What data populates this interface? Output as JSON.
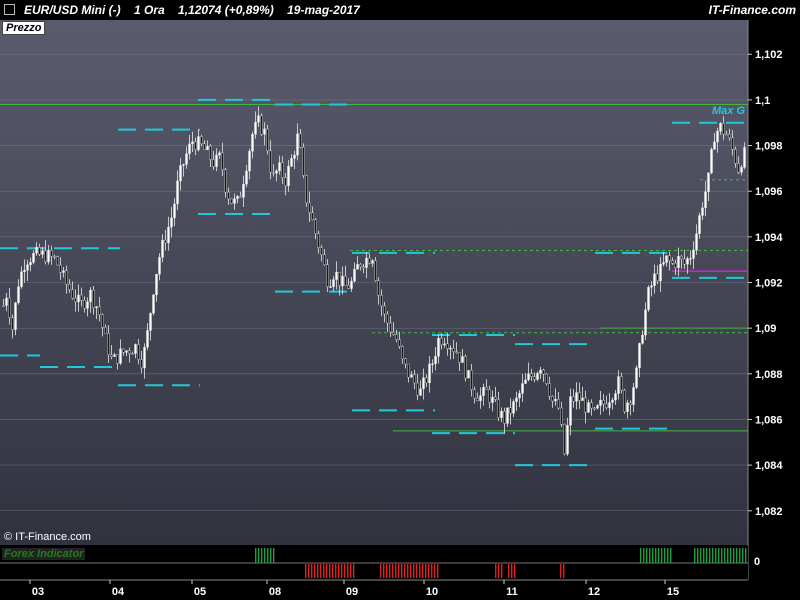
{
  "header": {
    "title": "EUR/USD Mini (-)",
    "timeframe": "1 Ora",
    "price": "1,12074 (+0,89%)",
    "date": "19-mag-2017",
    "brand": "IT-Finance.com"
  },
  "pane_label": "Prezzo",
  "copyright": "© IT-Finance.com",
  "max_label": "Max G",
  "indicator": {
    "label": "Forex Indicator",
    "value": "0"
  },
  "colors": {
    "bg_top": "#5a5c6e",
    "bg_bottom": "#30323e",
    "candle_up": "#ffffff",
    "candle_down": "#1a1a1a",
    "level_dash": "#22c8d8",
    "green_line": "#46b446",
    "purple_line": "#c030c0",
    "bar_green": "#1e9e3e",
    "bar_red": "#e02020"
  },
  "chart_data": {
    "type": "candlestick",
    "ylim": [
      1.0805,
      1.1035
    ],
    "yticks": [
      "1,102",
      "1,1",
      "1,098",
      "1,096",
      "1,094",
      "1,092",
      "1,09",
      "1,088",
      "1,086",
      "1,084",
      "1,082"
    ],
    "ytick_values": [
      1.102,
      1.1,
      1.098,
      1.096,
      1.094,
      1.092,
      1.09,
      1.088,
      1.086,
      1.084,
      1.082
    ],
    "xticks": [
      "03",
      "04",
      "05",
      "08",
      "09",
      "10",
      "11",
      "12",
      "15"
    ],
    "price_path": [
      [
        0,
        1.0905
      ],
      [
        6,
        1.0915
      ],
      [
        12,
        1.09
      ],
      [
        18,
        1.092
      ],
      [
        25,
        1.093
      ],
      [
        35,
        1.0932
      ],
      [
        45,
        1.0932
      ],
      [
        55,
        1.093
      ],
      [
        65,
        1.092
      ],
      [
        72,
        1.0915
      ],
      [
        80,
        1.091
      ],
      [
        90,
        1.0915
      ],
      [
        98,
        1.0908
      ],
      [
        105,
        1.0895
      ],
      [
        112,
        1.0885
      ],
      [
        118,
        1.0888
      ],
      [
        125,
        1.089
      ],
      [
        135,
        1.0892
      ],
      [
        142,
        1.0885
      ],
      [
        148,
        1.09
      ],
      [
        152,
        1.0915
      ],
      [
        158,
        1.093
      ],
      [
        165,
        1.094
      ],
      [
        172,
        1.095
      ],
      [
        178,
        1.0965
      ],
      [
        185,
        1.0975
      ],
      [
        192,
        1.0982
      ],
      [
        200,
        1.098
      ],
      [
        208,
        1.0976
      ],
      [
        214,
        1.0972
      ],
      [
        220,
        1.0975
      ],
      [
        226,
        1.096
      ],
      [
        232,
        1.0955
      ],
      [
        238,
        1.0955
      ],
      [
        245,
        1.097
      ],
      [
        252,
        1.0985
      ],
      [
        258,
        1.099
      ],
      [
        265,
        1.0985
      ],
      [
        272,
        1.0965
      ],
      [
        278,
        1.097
      ],
      [
        285,
        1.0965
      ],
      [
        292,
        1.0975
      ],
      [
        298,
        1.0985
      ],
      [
        304,
        1.096
      ],
      [
        310,
        1.095
      ],
      [
        316,
        1.094
      ],
      [
        322,
        1.093
      ],
      [
        328,
        1.092
      ],
      [
        334,
        1.0925
      ],
      [
        340,
        1.092
      ],
      [
        346,
        1.0918
      ],
      [
        352,
        1.092
      ],
      [
        358,
        1.0928
      ],
      [
        364,
        1.093
      ],
      [
        372,
        1.0932
      ],
      [
        378,
        1.0915
      ],
      [
        384,
        1.0905
      ],
      [
        390,
        1.09
      ],
      [
        396,
        1.0895
      ],
      [
        402,
        1.0885
      ],
      [
        408,
        1.088
      ],
      [
        414,
        1.0876
      ],
      [
        420,
        1.0872
      ],
      [
        426,
        1.0878
      ],
      [
        432,
        1.0885
      ],
      [
        438,
        1.0895
      ],
      [
        444,
        1.0896
      ],
      [
        450,
        1.0893
      ],
      [
        456,
        1.089
      ],
      [
        462,
        1.0885
      ],
      [
        468,
        1.0878
      ],
      [
        474,
        1.0872
      ],
      [
        480,
        1.087
      ],
      [
        486,
        1.0872
      ],
      [
        492,
        1.0868
      ],
      [
        498,
        1.0863
      ],
      [
        504,
        1.086
      ],
      [
        510,
        1.0864
      ],
      [
        516,
        1.0868
      ],
      [
        522,
        1.0874
      ],
      [
        528,
        1.0878
      ],
      [
        534,
        1.088
      ],
      [
        540,
        1.0884
      ],
      [
        546,
        1.0878
      ],
      [
        552,
        1.0868
      ],
      [
        558,
        1.0865
      ],
      [
        564,
        1.0845
      ],
      [
        570,
        1.0868
      ],
      [
        576,
        1.087
      ],
      [
        582,
        1.0868
      ],
      [
        588,
        1.0864
      ],
      [
        594,
        1.0862
      ],
      [
        600,
        1.0866
      ],
      [
        606,
        1.0868
      ],
      [
        612,
        1.0872
      ],
      [
        618,
        1.0876
      ],
      [
        624,
        1.0866
      ],
      [
        630,
        1.087
      ],
      [
        636,
        1.088
      ],
      [
        642,
        1.09
      ],
      [
        648,
        1.0915
      ],
      [
        654,
        1.0922
      ],
      [
        660,
        1.0925
      ],
      [
        666,
        1.093
      ],
      [
        672,
        1.0928
      ],
      [
        678,
        1.093
      ],
      [
        684,
        1.0928
      ],
      [
        690,
        1.0932
      ],
      [
        696,
        1.0942
      ],
      [
        702,
        1.0955
      ],
      [
        708,
        1.0965
      ],
      [
        714,
        1.0985
      ],
      [
        720,
        1.0988
      ],
      [
        726,
        1.0985
      ],
      [
        732,
        1.0978
      ],
      [
        738,
        1.097
      ],
      [
        742,
        1.0975
      ],
      [
        748,
        1.0978
      ]
    ],
    "levels": [
      {
        "y": 1.0935,
        "x": [
          0,
          120
        ]
      },
      {
        "y": 1.0888,
        "x": [
          0,
          40
        ]
      },
      {
        "y": 1.0883,
        "x": [
          40,
          120
        ]
      },
      {
        "y": 1.0875,
        "x": [
          118,
          200
        ]
      },
      {
        "y": 1.0987,
        "x": [
          118,
          200
        ]
      },
      {
        "y": 1.1,
        "x": [
          198,
          275
        ]
      },
      {
        "y": 1.095,
        "x": [
          198,
          275
        ]
      },
      {
        "y": 1.0998,
        "x": [
          275,
          355
        ]
      },
      {
        "y": 1.0916,
        "x": [
          275,
          355
        ]
      },
      {
        "y": 1.0933,
        "x": [
          352,
          435
        ]
      },
      {
        "y": 1.0864,
        "x": [
          352,
          435
        ]
      },
      {
        "y": 1.0897,
        "x": [
          432,
          515
        ]
      },
      {
        "y": 1.0854,
        "x": [
          432,
          515
        ]
      },
      {
        "y": 1.0893,
        "x": [
          515,
          595
        ]
      },
      {
        "y": 1.084,
        "x": [
          515,
          595
        ]
      },
      {
        "y": 1.0933,
        "x": [
          595,
          672
        ]
      },
      {
        "y": 1.0856,
        "x": [
          595,
          672
        ]
      },
      {
        "y": 1.099,
        "x": [
          672,
          748
        ]
      },
      {
        "y": 1.0922,
        "x": [
          672,
          748
        ]
      }
    ],
    "green_lines": [
      {
        "y": 1.0998,
        "x": [
          0,
          748
        ],
        "dashed": false
      },
      {
        "y": 1.0934,
        "x": [
          350,
          748
        ],
        "dashed": true
      },
      {
        "y": 1.0898,
        "x": [
          372,
          748
        ],
        "dashed": true
      },
      {
        "y": 1.09,
        "x": [
          600,
          748
        ],
        "dashed": false
      },
      {
        "y": 1.0855,
        "x": [
          393,
          748
        ],
        "dashed": false
      },
      {
        "y": 1.0965,
        "x": [
          700,
          748
        ],
        "dashed": true
      }
    ],
    "purple_line": {
      "y": 1.0925,
      "x": [
        672,
        748
      ]
    },
    "indicator_bars": {
      "green": [
        [
          255,
          275
        ],
        [
          640,
          672
        ],
        [
          694,
          748
        ]
      ],
      "red": [
        [
          305,
          355
        ],
        [
          380,
          440
        ],
        [
          495,
          502
        ],
        [
          508,
          515
        ],
        [
          560,
          566
        ]
      ]
    }
  }
}
